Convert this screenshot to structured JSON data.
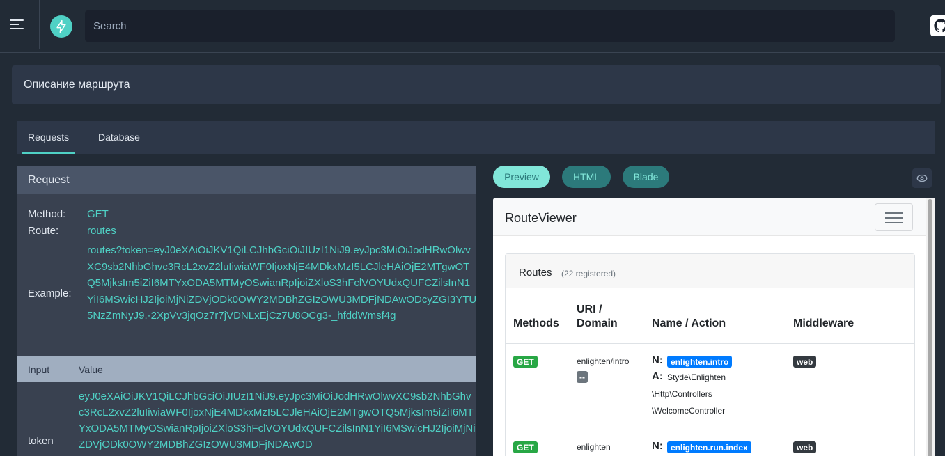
{
  "header": {
    "search_placeholder": "Search"
  },
  "description": "Описание маршрута",
  "tabs": [
    {
      "label": "Requests",
      "active": true
    },
    {
      "label": "Database",
      "active": false
    }
  ],
  "request": {
    "title": "Request",
    "method_label": "Method:",
    "method": "GET",
    "route_label": "Route:",
    "route": "routes",
    "example_label": "Example:",
    "example": "routes?token=eyJ0eXAiOiJKV1QiLCJhbGciOiJIUzI1NiJ9.eyJpc3MiOiJodHRwOlwvXC9sb2NhbGhvc3RcL2xvZ2luIiwiaWF0IjoxNjE4MDkxMzI5LCJleHAiOjE2MTgwOTQ5MjksIm5iZiI6MTYxODA5MTMyOSwianRpIjoiZXloS3hFclVOYUdxQUFCZilsInN1YiI6MSwicHJ2IjoiMjNiZDVjODk0OWY2MDBhZGIzOWU3MDFjNDAwODcyZGI3YTU5NzZmNyJ9.-2XpVv3jqOz7r7jVDNLxEjCz7U8OCg3-_hfddWmsf4g",
    "input_col": "Input",
    "value_col": "Value",
    "inputs": [
      {
        "name": "token",
        "value": "eyJ0eXAiOiJKV1QiLCJhbGciOiJIUzI1NiJ9.eyJpc3MiOiJodHRwOlwvXC9sb2NhbGhvc3RcL2xvZ2luIiwiaWF0IjoxNjE4MDkxMzI5LCJleHAiOjE2MTgwOTQ5MjksIm5iZiI6MTYxODA5MTMyOSwianRpIjoiZXloS3hFclVOYUdxQUFCZilsInN1YiI6MSwicHJ2IjoiMjNiZDVjODk0OWY2MDBhZGIzOWU3MDFjNDAwOD"
      }
    ]
  },
  "preview_tabs": [
    {
      "label": "Preview",
      "active": true
    },
    {
      "label": "HTML",
      "active": false
    },
    {
      "label": "Blade",
      "active": false
    }
  ],
  "preview": {
    "brand": "RouteViewer",
    "card_title": "Routes",
    "card_count": "(22 registered)",
    "columns": {
      "methods": "Methods",
      "uri_line1": "URI /",
      "uri_line2": "Domain",
      "name_action": "Name / Action",
      "middleware": "Middleware"
    },
    "rows": [
      {
        "method": "GET",
        "uri": "enlighten/intro",
        "domain": "--",
        "name_prefix": "N:",
        "name": "enlighten.intro",
        "action_prefix": "A:",
        "action_l1": "Styde\\Enlighten",
        "action_l2": "\\Http\\Controllers",
        "action_l3": "\\WelcomeController",
        "middleware": "web"
      },
      {
        "method": "GET",
        "uri": "enlighten",
        "name_prefix": "N:",
        "name": "enlighten.run.index",
        "middleware": "web"
      }
    ]
  },
  "colors": {
    "accent": "#4fd1c5",
    "background": "#222b36",
    "panel": "#2d3748",
    "get_badge": "#28a745",
    "name_badge": "#007bff"
  }
}
